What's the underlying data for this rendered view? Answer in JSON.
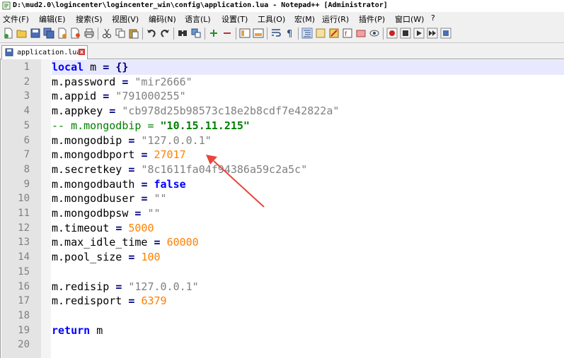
{
  "window": {
    "title": "D:\\mud2.0\\logincenter\\logincenter_win\\config\\application.lua - Notepad++ [Administrator]"
  },
  "menu": [
    "文件(F)",
    "编辑(E)",
    "搜索(S)",
    "视图(V)",
    "编码(N)",
    "语言(L)",
    "设置(T)",
    "工具(O)",
    "宏(M)",
    "运行(R)",
    "插件(P)",
    "窗口(W)",
    "?"
  ],
  "tab": {
    "label": "application.lua",
    "close": "x"
  },
  "editor": {
    "line_numbers": [
      "1",
      "2",
      "3",
      "4",
      "5",
      "6",
      "7",
      "8",
      "9",
      "10",
      "11",
      "12",
      "13",
      "14",
      "15",
      "16",
      "17",
      "18",
      "19",
      "20"
    ],
    "lines": [
      [
        {
          "t": "local",
          "c": "kw"
        },
        {
          "t": " m ",
          "c": "id"
        },
        {
          "t": "=",
          "c": "op"
        },
        {
          "t": " ",
          "c": "id"
        },
        {
          "t": "{}",
          "c": "op"
        }
      ],
      [
        {
          "t": "m.password ",
          "c": "id"
        },
        {
          "t": "=",
          "c": "op"
        },
        {
          "t": " \"mir2666\"",
          "c": "str"
        }
      ],
      [
        {
          "t": "m.appid ",
          "c": "id"
        },
        {
          "t": "=",
          "c": "op"
        },
        {
          "t": " \"791000255\"",
          "c": "str"
        }
      ],
      [
        {
          "t": "m.appkey ",
          "c": "id"
        },
        {
          "t": "=",
          "c": "op"
        },
        {
          "t": " \"cb978d25b98573c18e2b8cdf7e42822a\"",
          "c": "str"
        }
      ],
      [
        {
          "t": "-- m.mongodbip = ",
          "c": "cmt"
        },
        {
          "t": "\"10.15.11.215\"",
          "c": "cmtstr"
        }
      ],
      [
        {
          "t": "m.mongodbip ",
          "c": "id"
        },
        {
          "t": "=",
          "c": "op"
        },
        {
          "t": " \"127.0.0.1\"",
          "c": "str"
        }
      ],
      [
        {
          "t": "m.mongodbport ",
          "c": "id"
        },
        {
          "t": "=",
          "c": "op"
        },
        {
          "t": " ",
          "c": "id"
        },
        {
          "t": "27017",
          "c": "num"
        }
      ],
      [
        {
          "t": "m.secretkey ",
          "c": "id"
        },
        {
          "t": "=",
          "c": "op"
        },
        {
          "t": " \"8c1611fa04f94386a59c2a5c\"",
          "c": "str"
        }
      ],
      [
        {
          "t": "m.mongodbauth ",
          "c": "id"
        },
        {
          "t": "=",
          "c": "op"
        },
        {
          "t": " ",
          "c": "id"
        },
        {
          "t": "false",
          "c": "kw"
        }
      ],
      [
        {
          "t": "m.mongodbuser ",
          "c": "id"
        },
        {
          "t": "=",
          "c": "op"
        },
        {
          "t": " \"\"",
          "c": "str"
        }
      ],
      [
        {
          "t": "m.mongodbpsw ",
          "c": "id"
        },
        {
          "t": "=",
          "c": "op"
        },
        {
          "t": " \"\"",
          "c": "str"
        }
      ],
      [
        {
          "t": "m.timeout ",
          "c": "id"
        },
        {
          "t": "=",
          "c": "op"
        },
        {
          "t": " ",
          "c": "id"
        },
        {
          "t": "5000",
          "c": "num"
        }
      ],
      [
        {
          "t": "m.max_idle_time ",
          "c": "id"
        },
        {
          "t": "=",
          "c": "op"
        },
        {
          "t": " ",
          "c": "id"
        },
        {
          "t": "60000",
          "c": "num"
        }
      ],
      [
        {
          "t": "m.pool_size ",
          "c": "id"
        },
        {
          "t": "=",
          "c": "op"
        },
        {
          "t": " ",
          "c": "id"
        },
        {
          "t": "100",
          "c": "num"
        }
      ],
      [],
      [
        {
          "t": "m.redisip ",
          "c": "id"
        },
        {
          "t": "=",
          "c": "op"
        },
        {
          "t": " \"127.0.0.1\"",
          "c": "str"
        }
      ],
      [
        {
          "t": "m.redisport ",
          "c": "id"
        },
        {
          "t": "=",
          "c": "op"
        },
        {
          "t": " ",
          "c": "id"
        },
        {
          "t": "6379",
          "c": "num"
        }
      ],
      [],
      [
        {
          "t": "return",
          "c": "kw"
        },
        {
          "t": " m",
          "c": "id"
        }
      ],
      []
    ]
  },
  "colors": {
    "keyword": "#0000ff",
    "string": "#808080",
    "number": "#ff8000",
    "comment": "#008000",
    "annotation_arrow": "#e8453c"
  },
  "icons": [
    "new-file-icon",
    "open-file-icon",
    "save-icon",
    "save-all-icon",
    "close-icon",
    "close-all-icon",
    "print-icon",
    "cut-icon",
    "copy-icon",
    "paste-icon",
    "undo-icon",
    "redo-icon",
    "find-icon",
    "replace-icon",
    "zoom-in-icon",
    "zoom-out-icon",
    "sync-vertical-icon",
    "sync-horizontal-icon",
    "word-wrap-icon",
    "show-all-chars-icon",
    "indent-guide-icon",
    "user-lang-icon",
    "doc-map-icon",
    "function-list-icon",
    "folder-workspace-icon",
    "monitor-icon",
    "record-macro-icon",
    "stop-record-icon",
    "play-macro-icon",
    "run-macro-multiple-icon",
    "save-macro-icon"
  ]
}
